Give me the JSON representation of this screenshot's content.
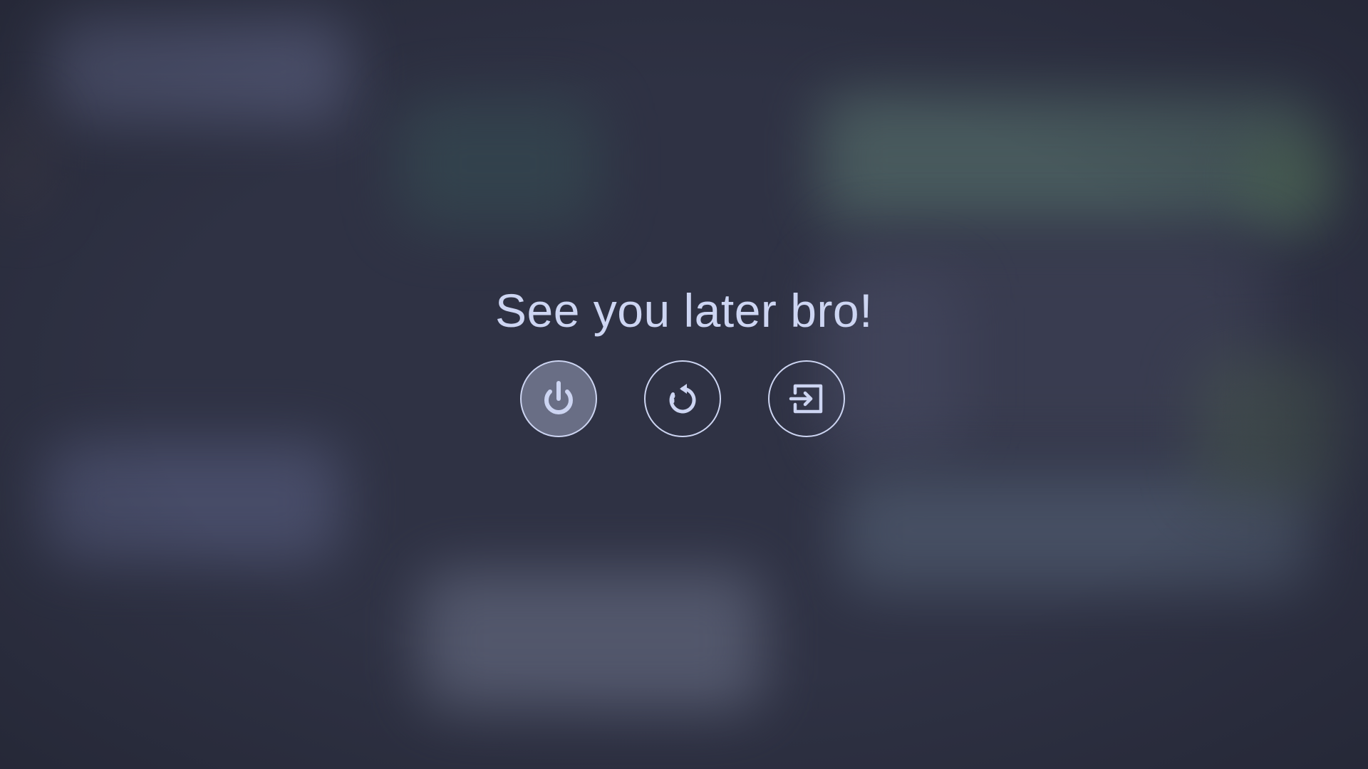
{
  "screen": {
    "message": "See you later bro!",
    "accent_color": "#cdd5f2",
    "background_color": "#2f3244"
  },
  "actions": [
    {
      "id": "shutdown",
      "icon": "power-icon",
      "selected": true
    },
    {
      "id": "reboot",
      "icon": "restart-icon",
      "selected": false
    },
    {
      "id": "logout",
      "icon": "logout-icon",
      "selected": false
    }
  ]
}
